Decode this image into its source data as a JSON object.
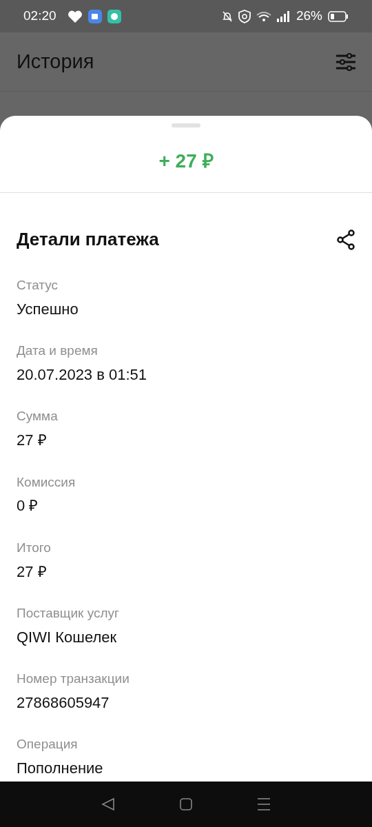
{
  "status_bar": {
    "time": "02:20",
    "battery": "26%"
  },
  "header": {
    "title": "История"
  },
  "sheet": {
    "amount": "+ 27 ₽",
    "title": "Детали платежа",
    "fields": [
      {
        "label": "Статус",
        "value": "Успешно"
      },
      {
        "label": "Дата и время",
        "value": "20.07.2023 в 01:51"
      },
      {
        "label": "Сумма",
        "value": "27 ₽"
      },
      {
        "label": "Комиссия",
        "value": "0 ₽"
      },
      {
        "label": "Итого",
        "value": "27 ₽"
      },
      {
        "label": "Поставщик услуг",
        "value": "QIWI Кошелек"
      },
      {
        "label": "Номер транзакции",
        "value": "27868605947"
      },
      {
        "label": "Операция",
        "value": "Пополнение"
      }
    ]
  }
}
